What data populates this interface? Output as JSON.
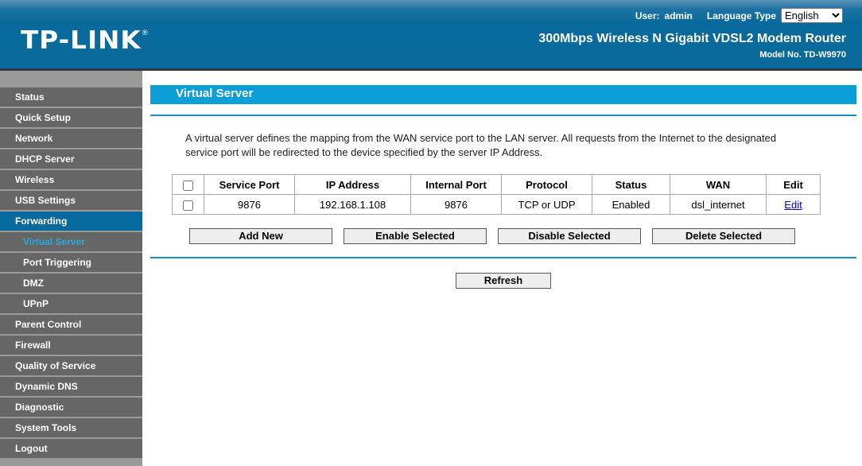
{
  "header": {
    "logo": "TP-LINK",
    "user_label": "User:",
    "user": "admin",
    "language_label": "Language Type",
    "language": "English",
    "product": "300Mbps Wireless N Gigabit VDSL2 Modem Router",
    "model": "Model No. TD-W9970"
  },
  "sidebar": {
    "items": [
      {
        "label": "Status"
      },
      {
        "label": "Quick Setup"
      },
      {
        "label": "Network"
      },
      {
        "label": "DHCP Server"
      },
      {
        "label": "Wireless"
      },
      {
        "label": "USB Settings"
      },
      {
        "label": "Forwarding",
        "active": true
      },
      {
        "label": "Virtual Server",
        "sub": true,
        "current": true
      },
      {
        "label": "Port Triggering",
        "sub": true
      },
      {
        "label": "DMZ",
        "sub": true
      },
      {
        "label": "UPnP",
        "sub": true
      },
      {
        "label": "Parent Control"
      },
      {
        "label": "Firewall"
      },
      {
        "label": "Quality of Service"
      },
      {
        "label": "Dynamic DNS"
      },
      {
        "label": "Diagnostic"
      },
      {
        "label": "System Tools"
      },
      {
        "label": "Logout"
      }
    ]
  },
  "main": {
    "title": "Virtual Server",
    "description": "A virtual server defines the mapping from the WAN service port to the LAN server. All requests from the Internet to the designated service port will be redirected to the device specified by the server IP Address.",
    "table": {
      "headers": [
        "",
        "Service Port",
        "IP Address",
        "Internal Port",
        "Protocol",
        "Status",
        "WAN",
        "Edit"
      ],
      "rows": [
        {
          "service_port": "9876",
          "ip": "192.168.1.108",
          "internal_port": "9876",
          "protocol": "TCP or UDP",
          "status": "Enabled",
          "wan": "dsl_internet",
          "edit": "Edit"
        }
      ]
    },
    "buttons": {
      "add": "Add New",
      "enable": "Enable Selected",
      "disable": "Disable Selected",
      "delete": "Delete Selected",
      "refresh": "Refresh"
    }
  },
  "colors": {
    "header": "#0a6a9c",
    "title_bar": "#0a9fd6",
    "nav": "#666666",
    "nav_active": "#086a9c"
  }
}
